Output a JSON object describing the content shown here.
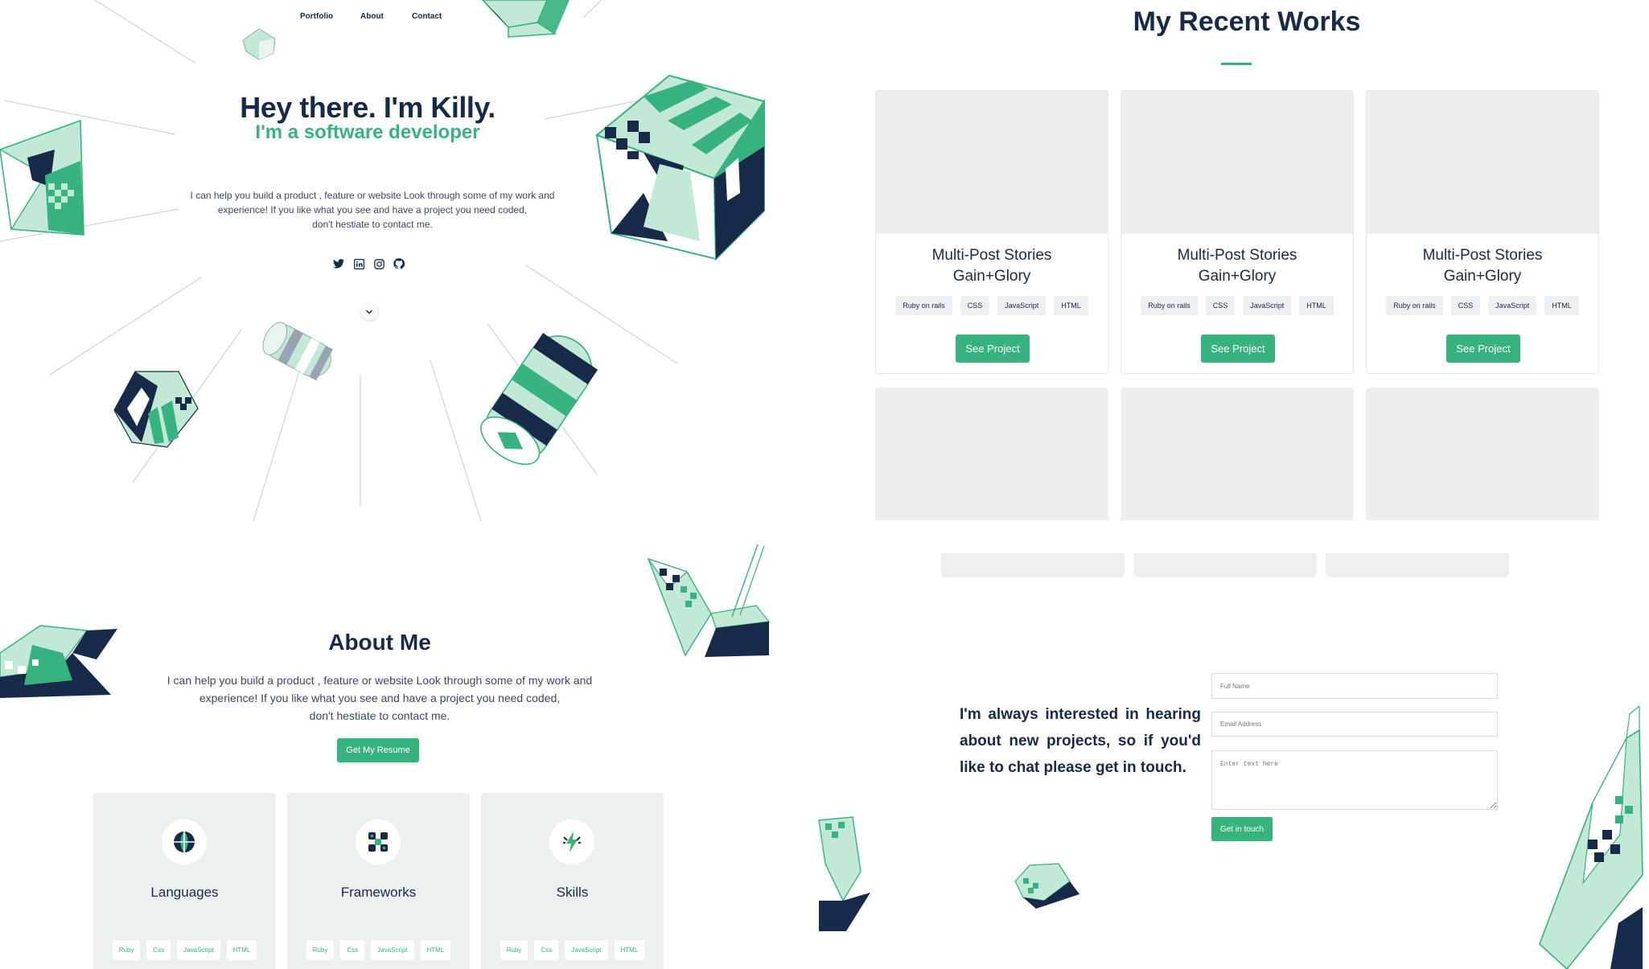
{
  "nav": {
    "portfolio": "Portfolio",
    "about": "About",
    "contact": "Contact"
  },
  "hero": {
    "title": "Hey there. I'm Killy.",
    "subtitle": "I'm a software developer",
    "intro_lines": [
      "I can help you build a product , feature or website Look through some of my work and",
      "experience! If you like what you see and have a project you need coded,",
      "don't hestiate to contact me."
    ],
    "social_icons": [
      "twitter-icon",
      "linkedin-icon",
      "instagram-icon",
      "github-icon"
    ]
  },
  "works": {
    "title": "My Recent Works",
    "projects": [
      {
        "title_line1": "Multi-Post Stories",
        "title_line2": "Gain+Glory",
        "tags": [
          "Ruby on rails",
          "CSS",
          "JavaScript",
          "HTML"
        ],
        "button": "See Project"
      },
      {
        "title_line1": "Multi-Post Stories",
        "title_line2": "Gain+Glory",
        "tags": [
          "Ruby on rails",
          "CSS",
          "JavaScript",
          "HTML"
        ],
        "button": "See Project"
      },
      {
        "title_line1": "Multi-Post Stories",
        "title_line2": "Gain+Glory",
        "tags": [
          "Ruby on rails",
          "CSS",
          "JavaScript",
          "HTML"
        ],
        "button": "See Project"
      }
    ]
  },
  "about": {
    "title": "About Me",
    "text_lines": [
      "I can help you build a product , feature or website Look through some of my work and",
      "experience! If you like what you see and have a project you need coded,",
      "don't hestiate to contact me."
    ],
    "resume_button": "Get My Resume",
    "cards": [
      {
        "name": "Languages",
        "icon": "globe-icon",
        "tags": [
          "Ruby",
          "Css",
          "JavaScript",
          "HTML"
        ]
      },
      {
        "name": "Frameworks",
        "icon": "modules-icon",
        "tags": [
          "Ruby",
          "Css",
          "JavaScript",
          "HTML"
        ]
      },
      {
        "name": "Skills",
        "icon": "lightning-icon",
        "tags": [
          "Ruby",
          "Css",
          "JavaScript",
          "HTML"
        ]
      }
    ]
  },
  "contact": {
    "message": "I'm always interested in hearing about new projects, so if you'd like to chat please get in touch.",
    "full_name_placeholder": "Full Name",
    "email_placeholder": "Email Address",
    "message_placeholder": "Enter text here",
    "submit": "Get in touch"
  },
  "colors": {
    "navy": "#172a4a",
    "green": "#36b37e",
    "mint": "#c2e8d6",
    "card_gray": "#edf0f0"
  }
}
